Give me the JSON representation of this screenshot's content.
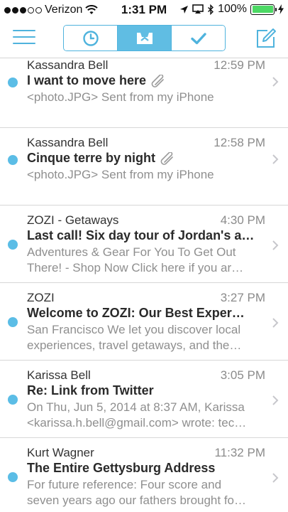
{
  "status_bar": {
    "carrier": "Verizon",
    "signal_dots_filled": 3,
    "signal_dots_total": 5,
    "time": "1:31 PM",
    "battery_percent": "100%",
    "battery_level": 1.0,
    "battery_color": "#4cd964"
  },
  "toolbar": {
    "menu_icon": "hamburger-menu-icon",
    "segments": [
      {
        "icon": "clock-icon",
        "active": false
      },
      {
        "icon": "inbox-tray-icon",
        "active": true
      },
      {
        "icon": "checkmark-icon",
        "active": false
      }
    ],
    "compose_icon": "compose-icon",
    "accent_color": "#4fb3dd"
  },
  "messages": [
    {
      "sender": "Kassandra Bell",
      "time": "12:59 PM",
      "subject": "I want to move here",
      "has_attachment": true,
      "preview": [
        "<photo.JPG> Sent from my iPhone"
      ],
      "unread": true
    },
    {
      "sender": "Kassandra Bell",
      "time": "12:58 PM",
      "subject": "Cinque terre by night",
      "has_attachment": true,
      "preview": [
        "<photo.JPG> Sent from my iPhone"
      ],
      "unread": true
    },
    {
      "sender": "ZOZI - Getaways",
      "time": "4:30 PM",
      "subject": "Last call! Six day tour of Jordan's a…",
      "has_attachment": false,
      "preview": [
        "Adventures & Gear For You To Get Out",
        "There! - Shop Now Click here if you ar…"
      ],
      "unread": true
    },
    {
      "sender": "ZOZI",
      "time": "3:27 PM",
      "subject": "Welcome to ZOZI: Our Best Exper…",
      "has_attachment": false,
      "preview": [
        "San Francisco We let you discover local",
        "experiences, travel getaways, and the…"
      ],
      "unread": true
    },
    {
      "sender": "Karissa Bell",
      "time": "3:05 PM",
      "subject": "Re: Link from Twitter",
      "has_attachment": false,
      "preview": [
        "On Thu, Jun 5, 2014 at 8:37 AM, Karissa",
        "<karissa.h.bell@gmail.com> wrote: tec…"
      ],
      "unread": true
    },
    {
      "sender": "Kurt Wagner",
      "time": "11:32 PM",
      "subject": "The Entire Gettysburg Address",
      "has_attachment": false,
      "preview": [
        "For future reference: Four score and",
        "seven years ago our fathers brought fo…"
      ],
      "unread": true
    }
  ]
}
